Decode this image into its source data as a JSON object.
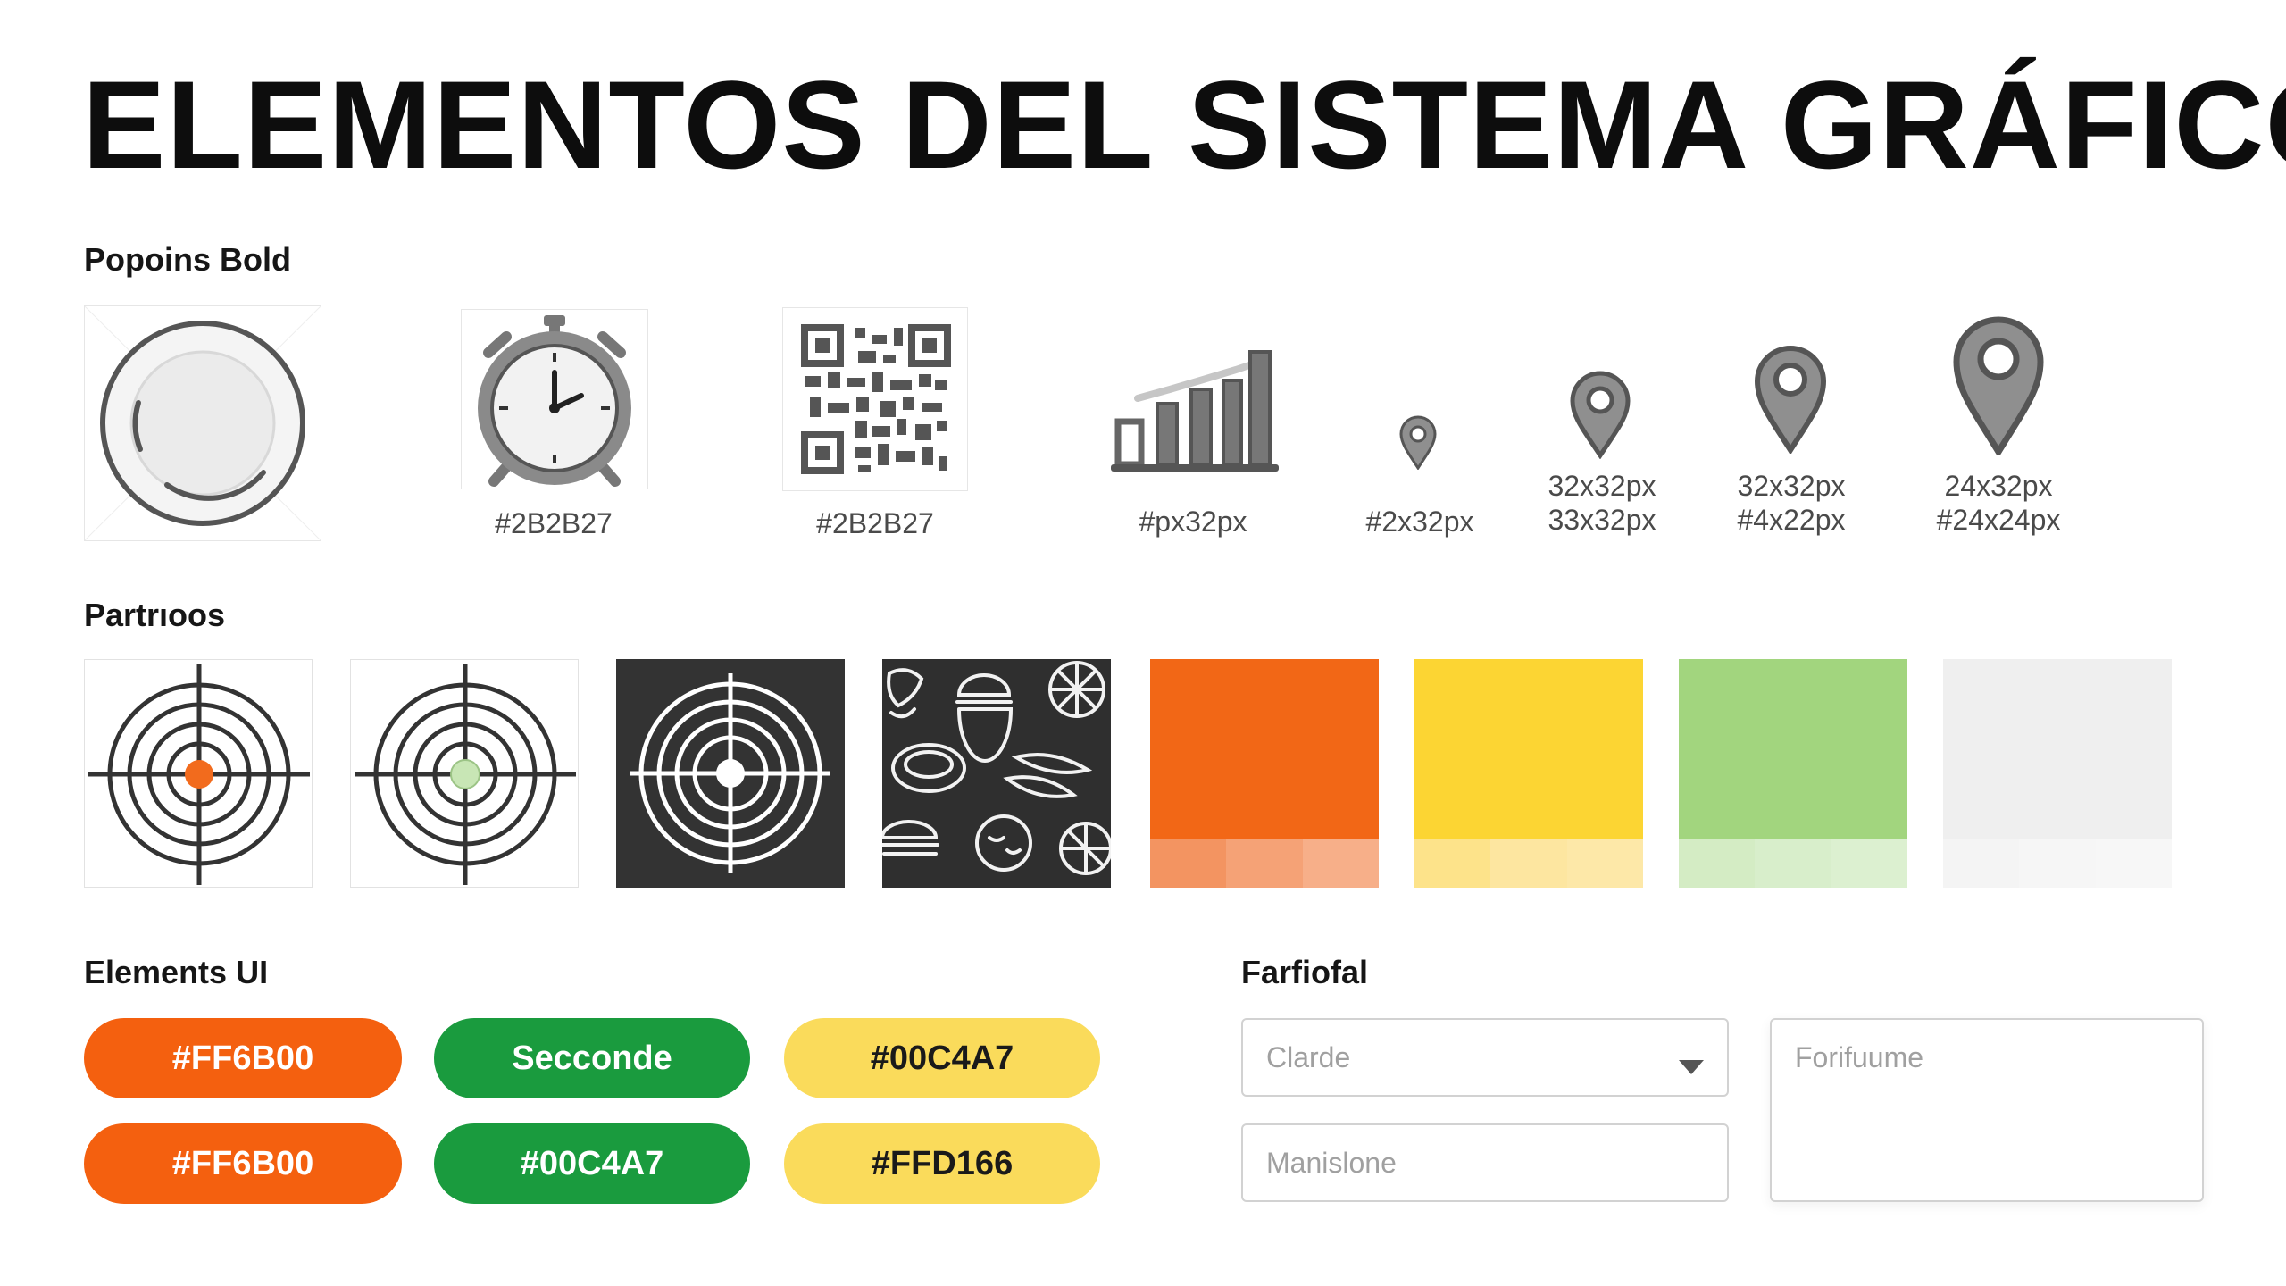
{
  "title": "ELEMENTOS DEL SISTEMA GRÁFICO",
  "sections": {
    "icons_label": "Popoins Bold",
    "patterns_label": "Partrıoos",
    "ui_label": "Elements UI",
    "forms_label": "Farfiofal"
  },
  "icons": [
    {
      "icon": "plate-icon",
      "caption": ""
    },
    {
      "icon": "stopwatch-icon",
      "caption": "#2B2B27"
    },
    {
      "icon": "qr-code-icon",
      "caption": "#2B2B27"
    },
    {
      "icon": "bar-chart-icon",
      "caption": "#px32px"
    },
    {
      "icon": "location-pin-icon",
      "caption": "#2x32px"
    },
    {
      "icon": "location-pin-icon",
      "caption": "32x32px",
      "caption2": "33x32px"
    },
    {
      "icon": "location-pin-icon",
      "caption": "32x32px",
      "caption2": "#4x22px"
    },
    {
      "icon": "location-pin-icon",
      "caption": "24x32px",
      "caption2": "#24x24px"
    }
  ],
  "patterns": [
    {
      "name": "target-orange",
      "bg": "#ffffff",
      "center": "#F26B1D"
    },
    {
      "name": "target-green",
      "bg": "#ffffff",
      "center": "#C8E6B5"
    },
    {
      "name": "target-dark",
      "bg": "#333333",
      "center": "#ffffff"
    },
    {
      "name": "food-pattern",
      "bg": "#2f2f2f"
    }
  ],
  "swatches": [
    {
      "main": "#F26716",
      "tints": [
        "#F39461",
        "#F5A276",
        "#F7AF89"
      ]
    },
    {
      "main": "#FCD533",
      "tints": [
        "#FDE38A",
        "#FDE6A0",
        "#FDE8A8"
      ]
    },
    {
      "main": "#A2D57E",
      "tints": [
        "#D4ECC4",
        "#D8EECB",
        "#DCF0D0"
      ]
    },
    {
      "main": "#EFEFEF",
      "tints": [
        "#F4F4F4",
        "#F6F6F6",
        "#F7F7F7"
      ]
    }
  ],
  "buttons": [
    {
      "label": "#FF6B00",
      "bg": "#F4600F",
      "color": "#ffffff"
    },
    {
      "label": "Secconde",
      "bg": "#1A9B3E",
      "color": "#ffffff"
    },
    {
      "label": "#00C4A7",
      "bg": "#FADB5B",
      "color": "#1a1a1a"
    },
    {
      "label": "#FF6B00",
      "bg": "#F4600F",
      "color": "#ffffff"
    },
    {
      "label": "#00C4A7",
      "bg": "#1A9B3E",
      "color": "#ffffff"
    },
    {
      "label": "#FFD166",
      "bg": "#FADB5B",
      "color": "#1a1a1a"
    }
  ],
  "form": {
    "select_placeholder": "Clarde",
    "input_placeholder": "Manislone",
    "textarea_placeholder": "Forifuume"
  }
}
